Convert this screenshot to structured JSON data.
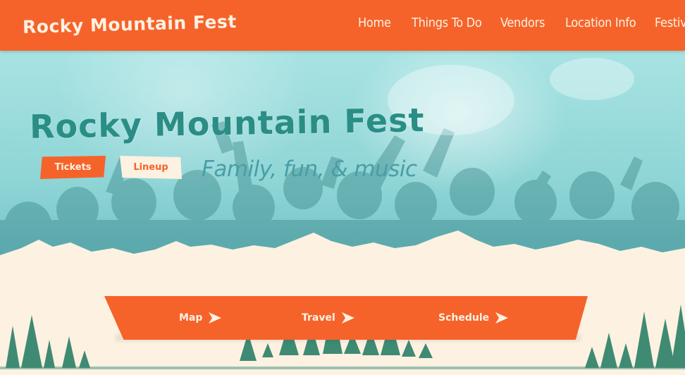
{
  "header": {
    "logo": "Rocky Mountain Fest",
    "nav": [
      "Home",
      "Things To Do",
      "Vendors",
      "Location Info",
      "Festiv"
    ]
  },
  "hero": {
    "title": "Rocky Mountain Fest",
    "tickets_label": "Tickets",
    "lineup_label": "Lineup",
    "tagline": "Family, fun, & music"
  },
  "links": [
    "Map",
    "Travel",
    "Schedule"
  ],
  "colors": {
    "orange": "#f5632a",
    "cream": "#fdf1e2",
    "teal": "#2a8d86",
    "tree": "#3f8a72"
  }
}
